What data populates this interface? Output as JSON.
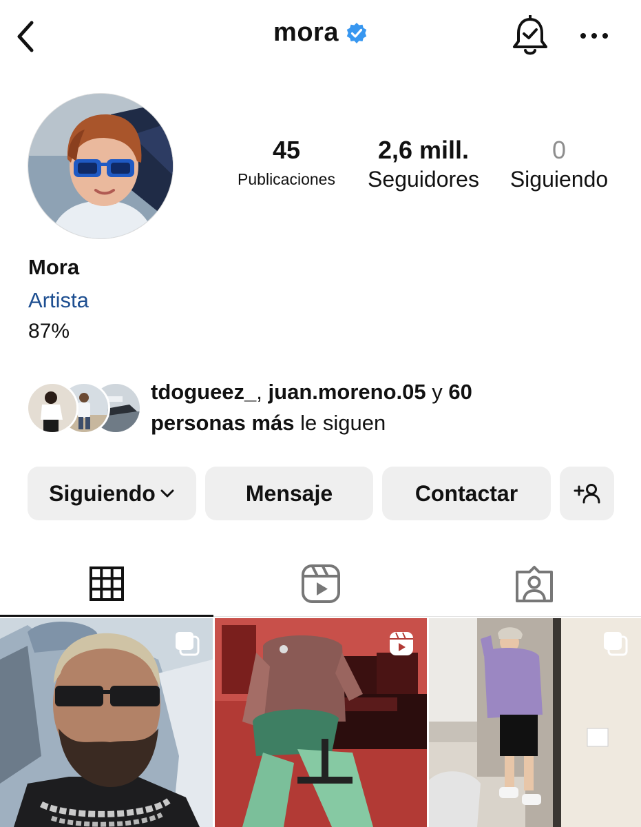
{
  "header": {
    "username": "mora",
    "back_icon": "chevron-left-icon",
    "verified_icon": "verified-badge-icon",
    "bell_icon": "bell-check-icon",
    "more_icon": "more-horizontal-icon"
  },
  "stats": {
    "posts_value": "45",
    "posts_label": "Publicaciones",
    "followers_value": "2,6 mill.",
    "followers_label": "Seguidores",
    "following_value": "0",
    "following_label": "Siguiendo"
  },
  "bio": {
    "name": "Mora",
    "category": "Artista",
    "text": "87%"
  },
  "mutual": {
    "user1": "tdogueez_",
    "sep1": ", ",
    "user2": "juan.moreno.05",
    "middle": " y ",
    "count": "60",
    "others": "personas más",
    "suffix": " le siguen"
  },
  "actions": {
    "following_label": "Siguiendo",
    "message_label": "Mensaje",
    "contact_label": "Contactar",
    "add_person_icon": "add-person-icon"
  },
  "tabs": {
    "grid_icon": "grid-icon",
    "reels_icon": "reels-icon",
    "tagged_icon": "tagged-icon",
    "active": "grid"
  },
  "colors": {
    "verified": "#3897f0",
    "category_link": "#1e4f91",
    "button_bg": "#efefef"
  },
  "posts": [
    {
      "type": "carousel",
      "badge_icon": "carousel-icon"
    },
    {
      "type": "reel",
      "badge_icon": "reels-icon"
    },
    {
      "type": "carousel",
      "badge_icon": "carousel-icon"
    }
  ]
}
